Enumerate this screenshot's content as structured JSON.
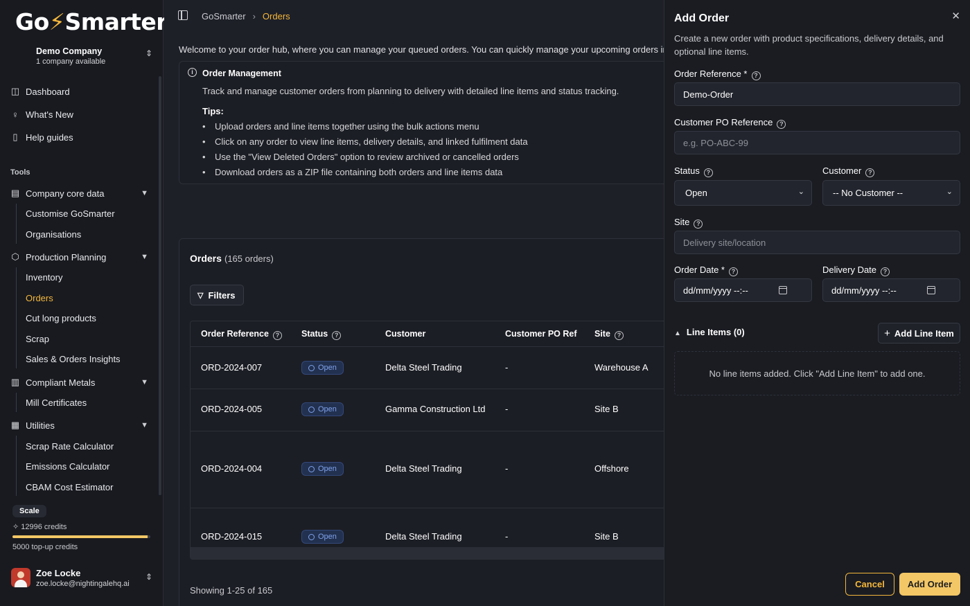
{
  "brand": {
    "logo_prefix": "Go",
    "logo_suffix": "Smarter",
    "accent": "#f5b73b"
  },
  "company": {
    "name": "Demo Company",
    "sub": "1 company available"
  },
  "nav": {
    "dashboard": "Dashboard",
    "whats_new": "What's New",
    "help": "Help guides",
    "tools_label": "Tools",
    "company_core": "Company core data",
    "customise": "Customise GoSmarter",
    "organisations": "Organisations",
    "production": "Production Planning",
    "inventory": "Inventory",
    "orders": "Orders",
    "cut_long": "Cut long products",
    "scrap": "Scrap",
    "sales_insights": "Sales & Orders Insights",
    "compliant": "Compliant Metals",
    "mill_certs": "Mill Certificates",
    "utilities": "Utilities",
    "scrap_calc": "Scrap Rate Calculator",
    "emissions": "Emissions Calculator",
    "cbam": "CBAM Cost Estimator"
  },
  "plan": {
    "badge": "Scale",
    "credits": "12996 credits",
    "credits_fraction": 0.98,
    "topup": "5000 top-up credits"
  },
  "user": {
    "name": "Zoe Locke",
    "email": "zoe.locke@nightingalehq.ai"
  },
  "breadcrumb": {
    "root": "GoSmarter",
    "current": "Orders"
  },
  "welcome": "Welcome to your order hub, where you can manage your queued orders. You can quickly manage your upcoming orders in t",
  "info": {
    "title": "Order Management",
    "desc": "Track and manage customer orders from planning to delivery with detailed line items and status tracking.",
    "tips_label": "Tips:",
    "tips": [
      "Upload orders and line items together using the bulk actions menu",
      "Click on any order to view line items, delivery details, and linked fulfilment data",
      "Use the \"View Deleted Orders\" option to review archived or cancelled orders",
      "Download orders as a ZIP file containing both orders and line items data"
    ]
  },
  "orders": {
    "title": "Orders",
    "count": "(165 orders)",
    "filters": "Filters",
    "columns": [
      "Order Reference",
      "Status",
      "Customer",
      "Customer PO Ref",
      "Site"
    ],
    "rows": [
      {
        "ref": "ORD-2024-007",
        "status": "Open",
        "customer": "Delta Steel Trading",
        "po": "-",
        "site": "Warehouse A"
      },
      {
        "ref": "ORD-2024-005",
        "status": "Open",
        "customer": "Gamma Construction Ltd",
        "po": "-",
        "site": "Site B"
      },
      {
        "ref": "ORD-2024-004",
        "status": "Open",
        "customer": "Delta Steel Trading",
        "po": "-",
        "site": "Offshore"
      },
      {
        "ref": "ORD-2024-015",
        "status": "Open",
        "customer": "Delta Steel Trading",
        "po": "-",
        "site": "Site B"
      }
    ],
    "showing": "Showing 1-25 of 165"
  },
  "drawer": {
    "title": "Add Order",
    "desc": "Create a new order with product specifications, delivery details, and optional line items.",
    "order_ref_label": "Order Reference *",
    "order_ref_value": "Demo-Order",
    "po_label": "Customer PO Reference",
    "po_placeholder": "e.g. PO-ABC-99",
    "status_label": "Status",
    "status_value": "Open",
    "customer_label": "Customer",
    "customer_value": "-- No Customer --",
    "site_label": "Site",
    "site_placeholder": "Delivery site/location",
    "order_date_label": "Order Date *",
    "order_date_placeholder": "dd/mm/yyyy --:--",
    "delivery_date_label": "Delivery Date",
    "delivery_date_placeholder": "dd/mm/yyyy --:--",
    "line_items_label": "Line Items (0)",
    "add_line_item": "Add Line Item",
    "empty_line_items": "No line items added. Click \"Add Line Item\" to add one.",
    "cancel": "Cancel",
    "submit": "Add Order"
  }
}
